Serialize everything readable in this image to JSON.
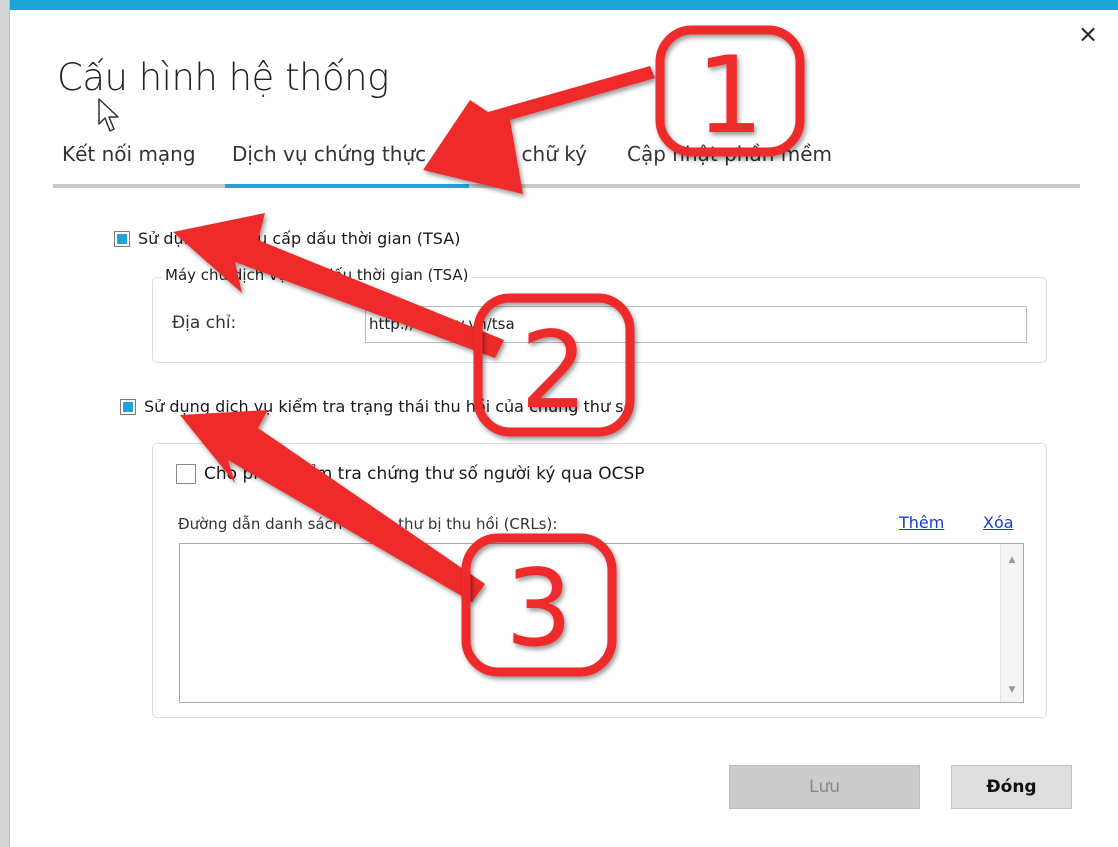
{
  "window": {
    "title": "Cấu hình hệ thống",
    "close_glyph": "×",
    "accent_color": "#1aa4d8"
  },
  "tabs": [
    {
      "label": "Kết nối mạng",
      "active": false
    },
    {
      "label": "Dịch vụ chứng thực",
      "active": true
    },
    {
      "label": "Mẫu chữ ký",
      "active": false
    },
    {
      "label": "Cập nhật phần mềm",
      "active": false
    }
  ],
  "tsa": {
    "checkbox_label": "Sử dụng dịch vụ cấp dấu thời gian (TSA)",
    "checked": true,
    "group_title": "Máy chủ dịch vụ cấp dấu thời gian (TSA)",
    "address_label": "Địa chỉ:",
    "address_value": "http://ca.gov.vn/tsa"
  },
  "revocation": {
    "checkbox_label": "Sử dụng dịch vụ kiểm tra trạng thái thu hồi của chứng thư số",
    "checked": true,
    "ocsp_label": "Cho phép kiểm tra chứng thư số người ký qua OCSP",
    "ocsp_checked": false,
    "crl_label": "Đường dẫn danh sách chứng thư bị thu hồi (CRLs):",
    "add_link": "Thêm",
    "delete_link": "Xóa",
    "crl_items": []
  },
  "buttons": {
    "save": "Lưu",
    "close": "Đóng"
  },
  "annotations": [
    {
      "number": "1",
      "color": "#ee2a2a"
    },
    {
      "number": "2",
      "color": "#ee2a2a"
    },
    {
      "number": "3",
      "color": "#ee2a2a"
    }
  ]
}
